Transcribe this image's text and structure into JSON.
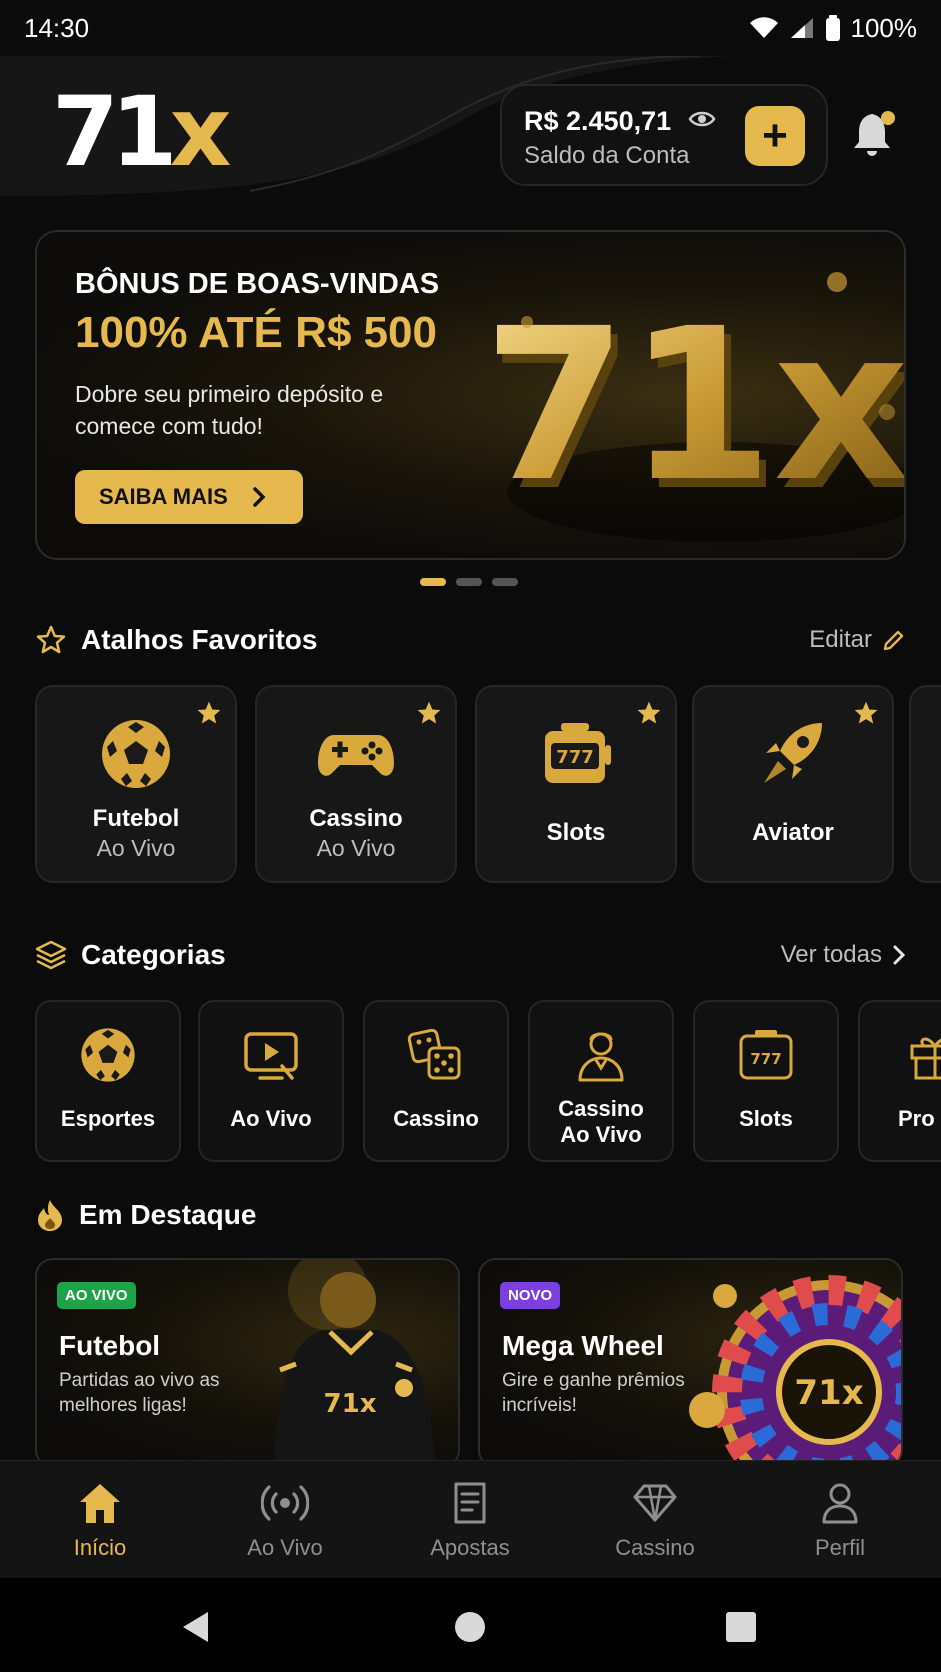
{
  "status_bar": {
    "time": "14:30",
    "battery": "100%"
  },
  "brand": {
    "logo_main": "71",
    "logo_accent": "x",
    "accent_color": "#e6b94f"
  },
  "balance": {
    "amount": "R$ 2.450,71",
    "label": "Saldo da Conta",
    "add_label": "+"
  },
  "banner": {
    "kicker": "BÔNUS DE BOAS-VINDAS",
    "title": "100% ATÉ R$ 500",
    "subtitle": "Dobre seu primeiro depósito e comece com tudo!",
    "cta": "SAIBA MAIS",
    "art_text": "71x",
    "slides": 3,
    "active_slide": 1
  },
  "favorites": {
    "title": "Atalhos Favoritos",
    "action": "Editar",
    "items": [
      {
        "line1": "Futebol",
        "line2": "Ao Vivo",
        "icon": "soccer-ball-icon"
      },
      {
        "line1": "Cassino",
        "line2": "Ao Vivo",
        "icon": "gamepad-icon"
      },
      {
        "line1": "Slots",
        "line2": "",
        "icon": "slot-machine-icon"
      },
      {
        "line1": "Aviator",
        "line2": "",
        "icon": "rocket-icon"
      }
    ]
  },
  "categories": {
    "title": "Categorias",
    "action": "Ver todas",
    "items": [
      {
        "line1": "Esportes",
        "line2": "",
        "icon": "soccer-ball-icon"
      },
      {
        "line1": "Ao Vivo",
        "line2": "",
        "icon": "live-tv-icon"
      },
      {
        "line1": "Cassino",
        "line2": "",
        "icon": "dice-icon"
      },
      {
        "line1": "Cassino",
        "line2": "Ao Vivo",
        "icon": "dealer-icon"
      },
      {
        "line1": "Slots",
        "line2": "",
        "icon": "slot-machine-icon"
      },
      {
        "line1": "Pro",
        "line2": "",
        "icon": "gift-icon"
      }
    ]
  },
  "featured": {
    "title": "Em Destaque",
    "items": [
      {
        "badge": "AO VIVO",
        "badge_color": "#1fa34a",
        "title": "Futebol",
        "subtitle": "Partidas ao vivo as melhores ligas!",
        "jersey_text": "71x"
      },
      {
        "badge": "NOVO",
        "badge_color": "#7c3fe0",
        "title": "Mega Wheel",
        "subtitle": "Gire e ganhe prêmios incríveis!",
        "wheel_text": "71x"
      }
    ]
  },
  "bottom_nav": {
    "items": [
      {
        "label": "Início",
        "active": true
      },
      {
        "label": "Ao Vivo",
        "active": false
      },
      {
        "label": "Apostas",
        "active": false
      },
      {
        "label": "Cassino",
        "active": false
      },
      {
        "label": "Perfil",
        "active": false
      }
    ]
  }
}
